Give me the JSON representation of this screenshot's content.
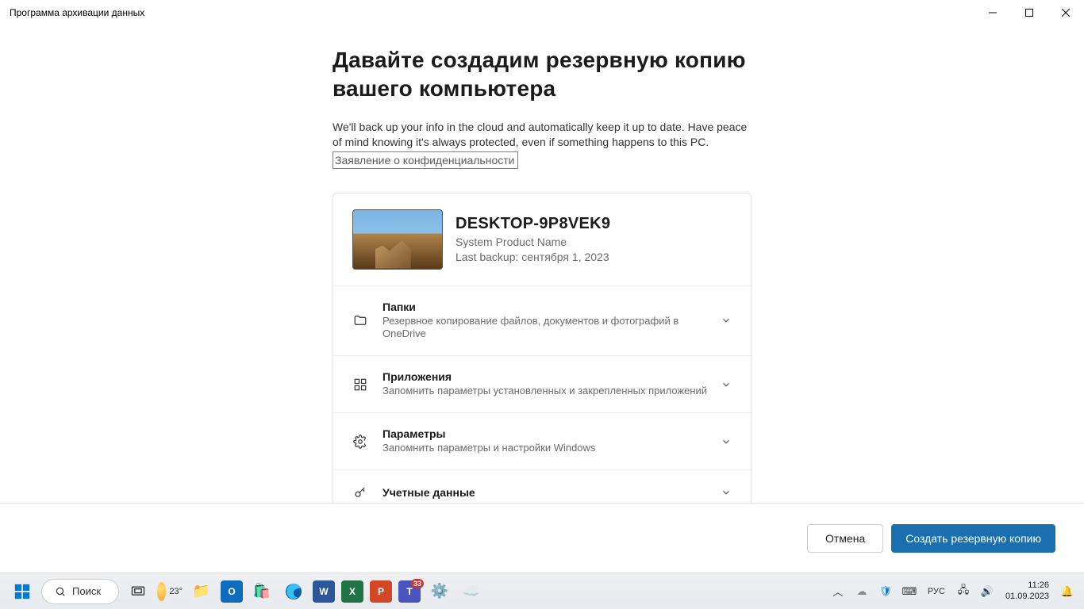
{
  "window": {
    "title": "Программа архивации данных"
  },
  "main": {
    "heading": "Давайте создадим резервную копию вашего компьютера",
    "description": "We'll back up your info in the cloud and automatically keep it up to date. Have peace of mind knowing it's always protected, even if something happens to this PC.",
    "privacy_link": "Заявление о конфиденциальности"
  },
  "device": {
    "name": "DESKTOP-9P8VEK9",
    "product": "System Product Name",
    "last_backup": "Last backup: сентября 1, 2023"
  },
  "options": [
    {
      "icon": "folder-icon",
      "title": "Папки",
      "subtitle": "Резервное копирование файлов, документов и фотографий в OneDrive"
    },
    {
      "icon": "apps-icon",
      "title": "Приложения",
      "subtitle": "Запомнить параметры установленных и закрепленных приложений"
    },
    {
      "icon": "gear-icon",
      "title": "Параметры",
      "subtitle": "Запомнить параметры и настройки Windows"
    },
    {
      "icon": "key-icon",
      "title": "Учетные данные",
      "subtitle": ""
    }
  ],
  "footer": {
    "cancel": "Отмена",
    "primary": "Создать резервную копию"
  },
  "taskbar": {
    "search_label": "Поиск",
    "weather_temp": "23°",
    "teams_badge": "33",
    "language": "РУС",
    "time": "11:26",
    "date": "01.09.2023"
  }
}
